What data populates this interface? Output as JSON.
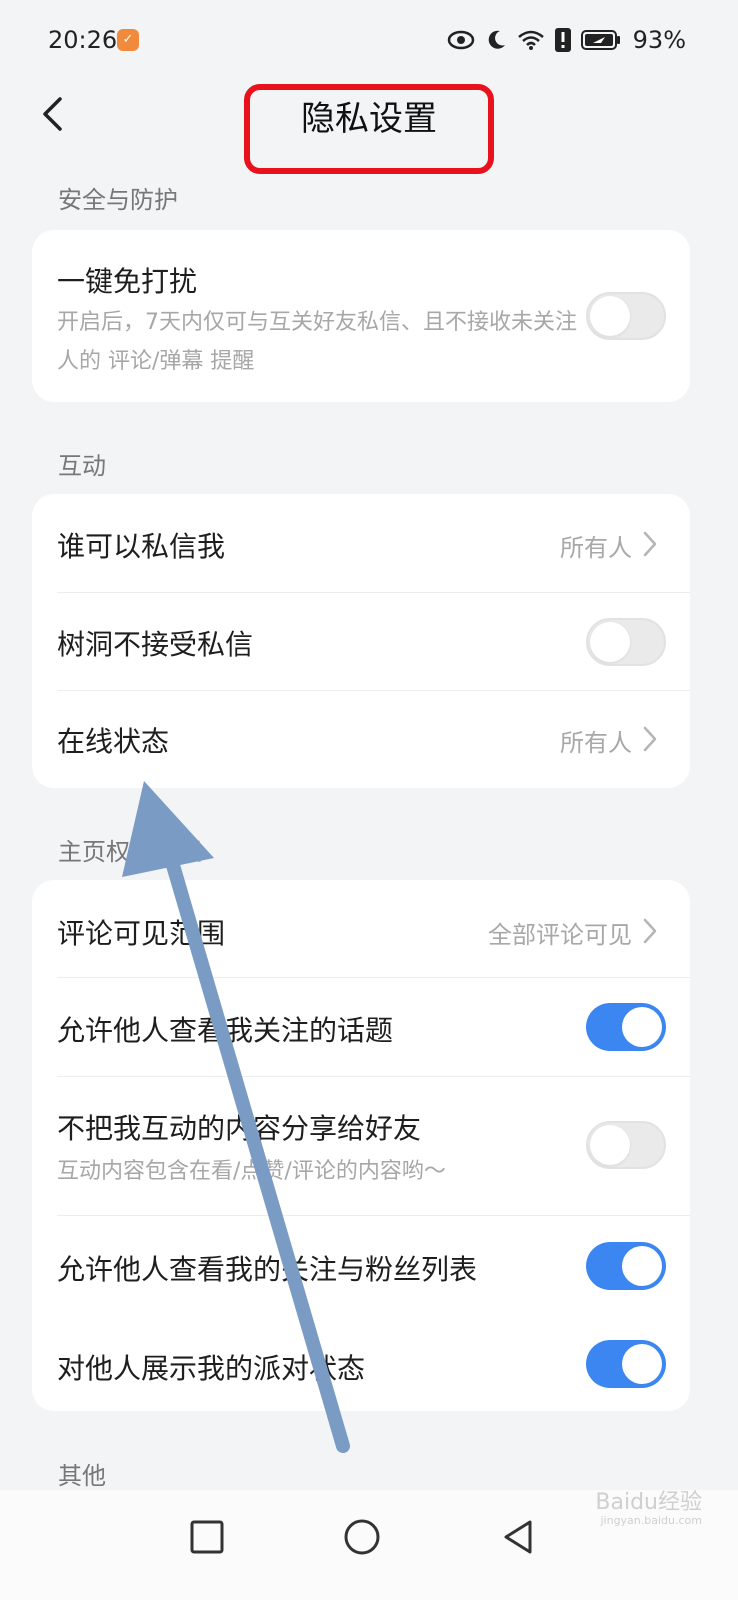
{
  "status_bar": {
    "time": "20:26",
    "app_badge": "✓",
    "battery_percent": "93%",
    "icons": [
      "eye-icon",
      "moon-icon",
      "wifi-icon",
      "alert-icon",
      "battery-icon"
    ]
  },
  "header": {
    "title": "隐私设置",
    "back_icon": "back-chevron-icon"
  },
  "sections": {
    "security": {
      "label": "安全与防护",
      "items": [
        {
          "label": "一键免打扰",
          "description": "开启后，7天内仅可与互关好友私信、且不接收未关注人的 评论/弹幕 提醒",
          "toggle": false
        }
      ]
    },
    "interaction": {
      "label": "互动",
      "items": [
        {
          "label": "谁可以私信我",
          "value": "所有人"
        },
        {
          "label": "树洞不接受私信",
          "toggle": false
        },
        {
          "label": "在线状态",
          "value": "所有人"
        }
      ]
    },
    "homepage": {
      "label": "主页权限设置",
      "items": [
        {
          "label": "评论可见范围",
          "value": "全部评论可见"
        },
        {
          "label": "允许他人查看我关注的话题",
          "toggle": true
        },
        {
          "label": "不把我互动的内容分享给好友",
          "description": "互动内容包含在看/点赞/评论的内容哟～",
          "toggle": false
        },
        {
          "label": "允许他人查看我的关注与粉丝列表",
          "toggle": true
        },
        {
          "label": "对他人展示我的派对状态",
          "toggle": true
        }
      ]
    },
    "other": {
      "label": "其他"
    }
  },
  "bottom_nav": {
    "icons": [
      "recent-apps-icon",
      "home-icon",
      "back-triangle-icon"
    ]
  },
  "watermark": {
    "brand": "Baidu经验",
    "url": "jingyan.baidu.com"
  },
  "colors": {
    "background": "#f3f4f6",
    "toggle_on": "#3b86f0",
    "highlight_box": "#e8121d",
    "annotation_arrow": "#7a9bc4"
  }
}
